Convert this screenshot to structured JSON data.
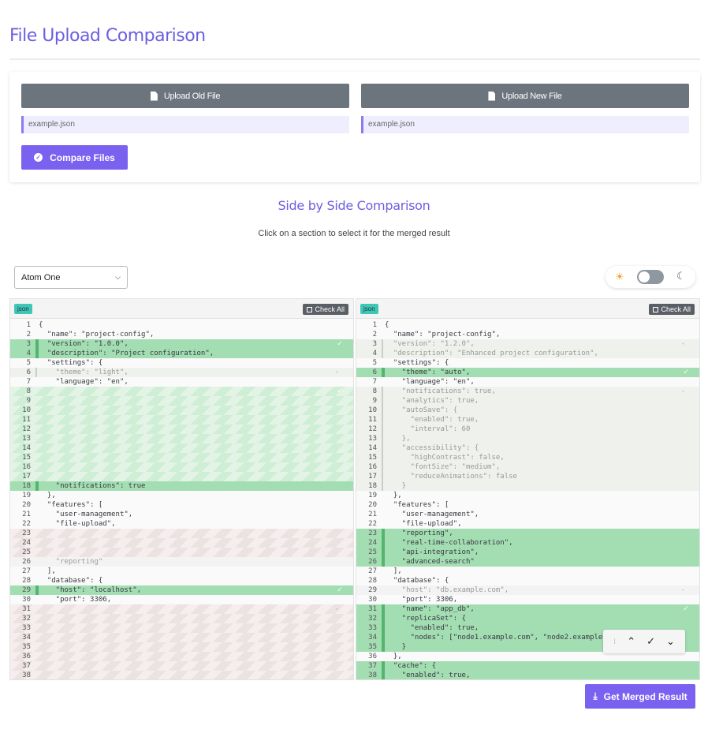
{
  "page": {
    "title": "File Upload Comparison",
    "subtitle": "Side by Side Comparison",
    "hint": "Click on a section to select it for the merged result"
  },
  "upload": {
    "old_label": "Upload Old File",
    "new_label": "Upload New File",
    "old_filename": "example.json",
    "new_filename": "example.json",
    "compare_label": "Compare Files"
  },
  "toolbar": {
    "theme_select_value": "Atom One",
    "theme_mode": "light",
    "sun_icon": "☀",
    "moon_icon": "☾"
  },
  "left_pane": {
    "lang": "json",
    "check_all": "Check All",
    "lines": [
      {
        "n": "1",
        "t": "{",
        "style": ""
      },
      {
        "n": "2",
        "t": "  \"name\": \"project-config\",",
        "style": ""
      },
      {
        "n": "3",
        "t": "  \"version\": \"1.0.0\",",
        "style": "add",
        "mark": "✓"
      },
      {
        "n": "4",
        "t": "  \"description\": \"Project configuration\",",
        "style": "add"
      },
      {
        "n": "5",
        "t": "  \"settings\": {",
        "style": ""
      },
      {
        "n": "6",
        "t": "    \"theme\": \"light\",",
        "style": "dimbg dim",
        "mark": "-"
      },
      {
        "n": "7",
        "t": "    \"language\": \"en\",",
        "style": ""
      },
      {
        "n": "8",
        "t": "",
        "style": "stripeg",
        "mark": "✓"
      },
      {
        "n": "9",
        "t": "",
        "style": "stripeg"
      },
      {
        "n": "10",
        "t": "",
        "style": "stripeg"
      },
      {
        "n": "11",
        "t": "",
        "style": "stripeg"
      },
      {
        "n": "12",
        "t": "",
        "style": "stripeg"
      },
      {
        "n": "13",
        "t": "",
        "style": "stripeg"
      },
      {
        "n": "14",
        "t": "",
        "style": "stripeg"
      },
      {
        "n": "15",
        "t": "",
        "style": "stripeg"
      },
      {
        "n": "16",
        "t": "",
        "style": "stripeg"
      },
      {
        "n": "17",
        "t": "",
        "style": "stripeg"
      },
      {
        "n": "18",
        "t": "    \"notifications\": true",
        "style": "add"
      },
      {
        "n": "19",
        "t": "  },",
        "style": ""
      },
      {
        "n": "20",
        "t": "  \"features\": [",
        "style": ""
      },
      {
        "n": "21",
        "t": "    \"user-management\",",
        "style": ""
      },
      {
        "n": "22",
        "t": "    \"file-upload\",",
        "style": ""
      },
      {
        "n": "23",
        "t": "",
        "style": "striper"
      },
      {
        "n": "24",
        "t": "",
        "style": "striper"
      },
      {
        "n": "25",
        "t": "",
        "style": "striper"
      },
      {
        "n": "26",
        "t": "    \"reporting\"",
        "style": "faint dim"
      },
      {
        "n": "27",
        "t": "  ],",
        "style": ""
      },
      {
        "n": "28",
        "t": "  \"database\": {",
        "style": "cut"
      },
      {
        "n": "29",
        "t": "    \"host\": \"localhost\",",
        "style": "add",
        "mark": "✓"
      },
      {
        "n": "30",
        "t": "    \"port\": 3306,",
        "style": ""
      },
      {
        "n": "31",
        "t": "",
        "style": "striper",
        "mark": "-"
      },
      {
        "n": "32",
        "t": "",
        "style": "striper"
      },
      {
        "n": "33",
        "t": "",
        "style": "striper"
      },
      {
        "n": "34",
        "t": "",
        "style": "striper"
      },
      {
        "n": "35",
        "t": "",
        "style": "striper"
      },
      {
        "n": "36",
        "t": "",
        "style": "striper"
      },
      {
        "n": "37",
        "t": "",
        "style": "striper"
      },
      {
        "n": "38",
        "t": "",
        "style": "striper"
      }
    ]
  },
  "right_pane": {
    "lang": "json",
    "check_all": "Check All",
    "lines": [
      {
        "n": "1",
        "t": "{",
        "style": ""
      },
      {
        "n": "2",
        "t": "  \"name\": \"project-config\",",
        "style": ""
      },
      {
        "n": "3",
        "t": "  \"version\": \"1.2.0\",",
        "style": "dimbg dim",
        "mark": "-"
      },
      {
        "n": "4",
        "t": "  \"description\": \"Enhanced project configuration\",",
        "style": "dimbg dim"
      },
      {
        "n": "5",
        "t": "  \"settings\": {",
        "style": ""
      },
      {
        "n": "6",
        "t": "    \"theme\": \"auto\",",
        "style": "add",
        "mark": "✓"
      },
      {
        "n": "7",
        "t": "    \"language\": \"en\",",
        "style": ""
      },
      {
        "n": "8",
        "t": "    \"notifications\": true,",
        "style": "dimbg dim",
        "mark": "-"
      },
      {
        "n": "9",
        "t": "    \"analytics\": true,",
        "style": "dimbg dim"
      },
      {
        "n": "10",
        "t": "    \"autoSave\": {",
        "style": "dimbg dim"
      },
      {
        "n": "11",
        "t": "      \"enabled\": true,",
        "style": "dimbg dim"
      },
      {
        "n": "12",
        "t": "      \"interval\": 60",
        "style": "dimbg dim"
      },
      {
        "n": "13",
        "t": "    },",
        "style": "dimbg dim"
      },
      {
        "n": "14",
        "t": "    \"accessibility\": {",
        "style": "dimbg dim"
      },
      {
        "n": "15",
        "t": "      \"highContrast\": false,",
        "style": "dimbg dim"
      },
      {
        "n": "16",
        "t": "      \"fontSize\": \"medium\",",
        "style": "dimbg dim"
      },
      {
        "n": "17",
        "t": "      \"reduceAnimations\": false",
        "style": "dimbg dim"
      },
      {
        "n": "18",
        "t": "    }",
        "style": "dimbg dim"
      },
      {
        "n": "19",
        "t": "  },",
        "style": ""
      },
      {
        "n": "20",
        "t": "  \"features\": [",
        "style": ""
      },
      {
        "n": "21",
        "t": "    \"user-management\",",
        "style": ""
      },
      {
        "n": "22",
        "t": "    \"file-upload\",",
        "style": ""
      },
      {
        "n": "23",
        "t": "    \"reporting\",",
        "style": "add"
      },
      {
        "n": "24",
        "t": "    \"real-time-collaboration\",",
        "style": "add"
      },
      {
        "n": "25",
        "t": "    \"api-integration\",",
        "style": "add"
      },
      {
        "n": "26",
        "t": "    \"advanced-search\"",
        "style": "add"
      },
      {
        "n": "27",
        "t": "  ],",
        "style": ""
      },
      {
        "n": "28",
        "t": "  \"database\": {",
        "style": "cut"
      },
      {
        "n": "29",
        "t": "    \"host\": \"db.example.com\",",
        "style": "faint dim",
        "mark": "-"
      },
      {
        "n": "30",
        "t": "    \"port\": 3306,",
        "style": ""
      },
      {
        "n": "31",
        "t": "    \"name\": \"app_db\",",
        "style": "add",
        "mark": "✓"
      },
      {
        "n": "32",
        "t": "    \"replicaSet\": {",
        "style": "add"
      },
      {
        "n": "33",
        "t": "      \"enabled\": true,",
        "style": "add"
      },
      {
        "n": "34",
        "t": "      \"nodes\": [\"node1.example.com\", \"node2.example.com\"]",
        "style": "add"
      },
      {
        "n": "35",
        "t": "    }",
        "style": "add"
      },
      {
        "n": "36",
        "t": "  },",
        "style": ""
      },
      {
        "n": "37",
        "t": "  \"cache\": {",
        "style": "add"
      },
      {
        "n": "38",
        "t": "    \"enabled\": true,",
        "style": "add"
      }
    ]
  },
  "nav": {
    "grip": "⁞",
    "up": "⌃",
    "accept": "✓",
    "down": "⌄"
  },
  "actions": {
    "merge_label": "Get Merged Result"
  },
  "colors": {
    "accent": "#7b61f0",
    "title": "#6d5fe0",
    "added": "#a3ddb2",
    "upload_button": "#6c757d"
  }
}
